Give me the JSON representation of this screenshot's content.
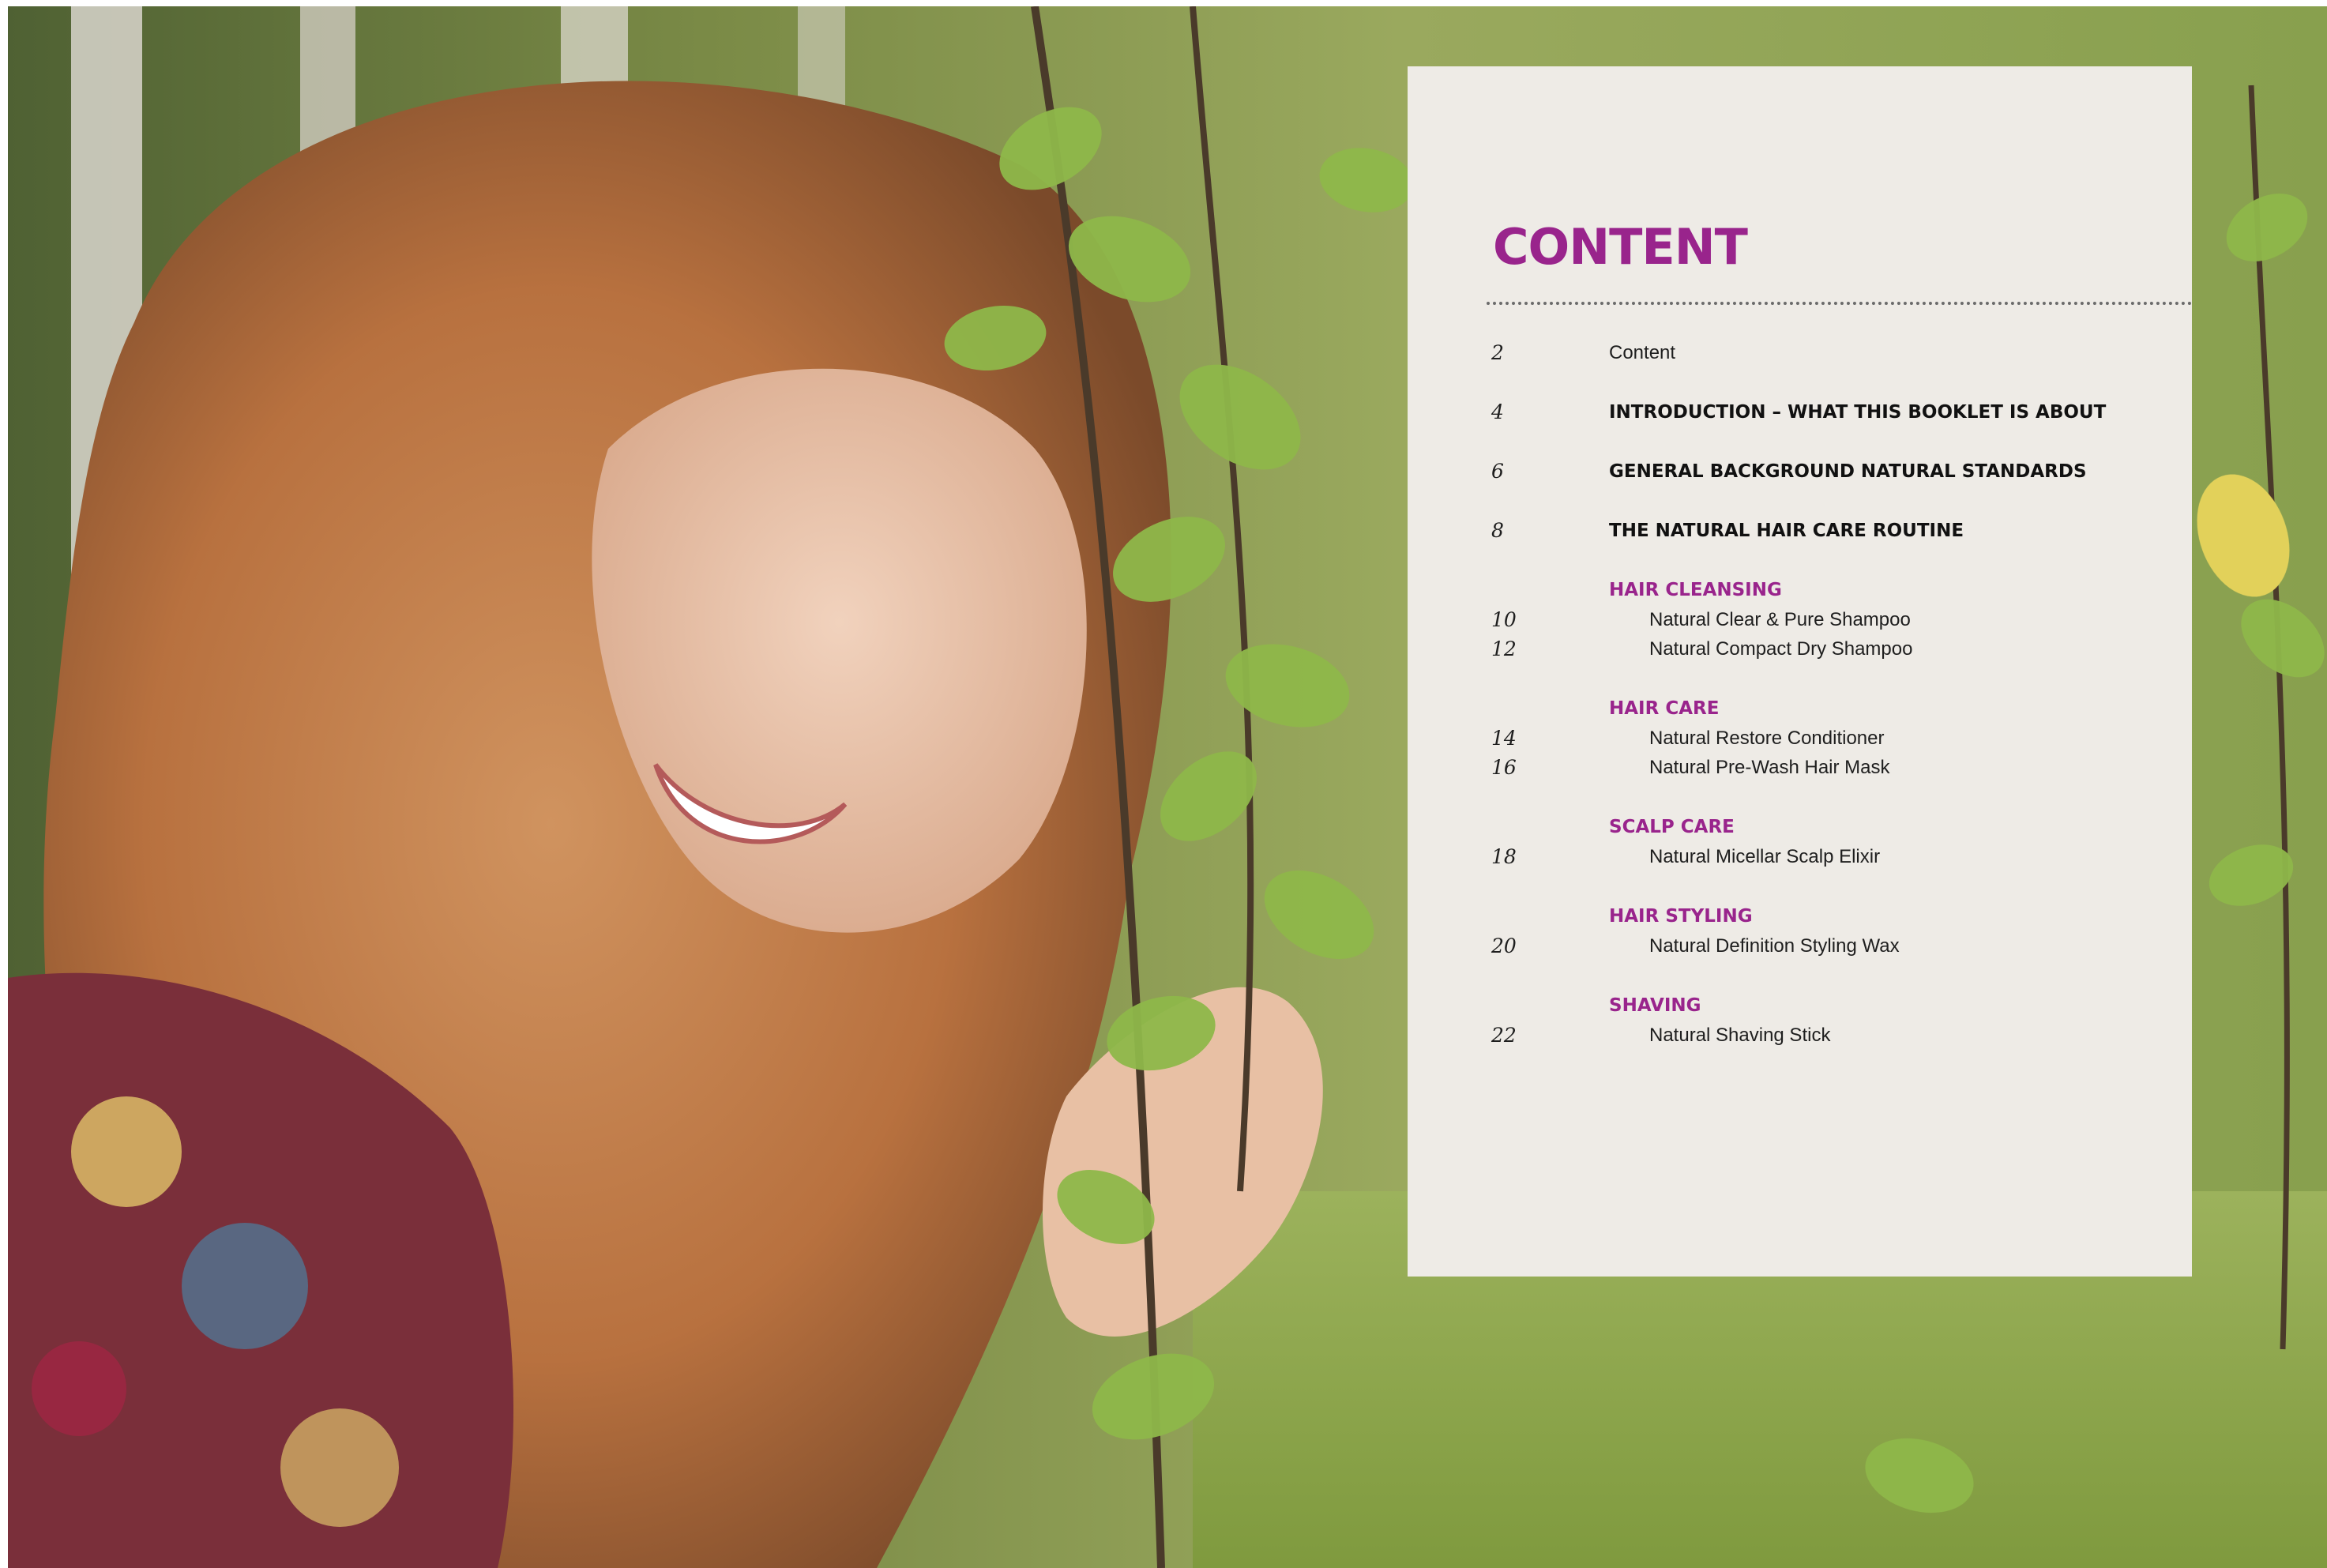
{
  "photo": {
    "description_icon": "photo-woman-with-birch-leaves"
  },
  "colors": {
    "accent": "#99248c",
    "panel": "#eeebe6",
    "text": "#1e1e1e"
  },
  "contents": {
    "title": "CONTENT",
    "entries": [
      {
        "page": "2",
        "label": "Content"
      },
      {
        "page": "4",
        "label": "INTRODUCTION – WHAT THIS BOOKLET IS ABOUT"
      },
      {
        "page": "6",
        "label": "GENERAL BACKGROUND NATURAL STANDARDS"
      },
      {
        "page": "8",
        "label": "THE NATURAL HAIR CARE ROUTINE"
      }
    ],
    "sections": [
      {
        "heading": "HAIR CLEANSING",
        "items": [
          {
            "page": "10",
            "label": "Natural Clear & Pure Shampoo"
          },
          {
            "page": "12",
            "label": "Natural Compact Dry Shampoo"
          }
        ]
      },
      {
        "heading": "HAIR CARE",
        "items": [
          {
            "page": "14",
            "label": "Natural Restore Conditioner"
          },
          {
            "page": "16",
            "label": "Natural Pre-Wash Hair Mask"
          }
        ]
      },
      {
        "heading": "SCALP CARE",
        "items": [
          {
            "page": "18",
            "label": "Natural Micellar Scalp Elixir"
          }
        ]
      },
      {
        "heading": "HAIR STYLING",
        "items": [
          {
            "page": "20",
            "label": "Natural Definition Styling Wax"
          }
        ]
      },
      {
        "heading": "SHAVING",
        "items": [
          {
            "page": "22",
            "label": "Natural Shaving Stick"
          }
        ]
      }
    ]
  }
}
